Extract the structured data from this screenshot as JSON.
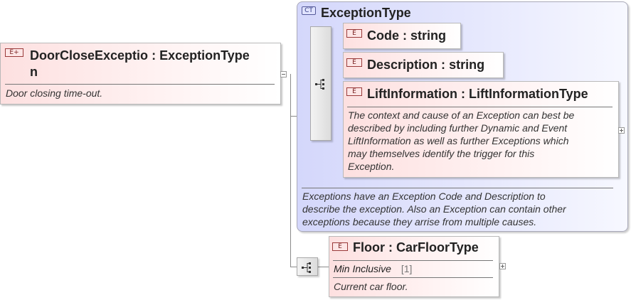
{
  "root_element": {
    "badge": "E",
    "name": "DoorCloseExceptio",
    "name_cont": "n",
    "type": "ExceptionType",
    "doc": "Door closing time-out."
  },
  "complex_type": {
    "badge": "CT",
    "name": "ExceptionType",
    "doc_lines": [
      "Exceptions have an Exception Code and Description to",
      "describe the exception. Also an Exception can contain other",
      "exceptions because they arrise from multiple causes."
    ]
  },
  "children": [
    {
      "badge": "E",
      "name": "Code",
      "type": "string"
    },
    {
      "badge": "E",
      "name": "Description",
      "type": "string"
    },
    {
      "badge": "E",
      "name": "LiftInformation",
      "type": "LiftInformationType",
      "doc_lines": [
        "The context and cause of an Exception can best be",
        "described by including further Dynamic and Event",
        "LiftInformation as well as further Exceptions which",
        "may themselves identify the trigger for this",
        "Exception."
      ]
    }
  ],
  "floor_element": {
    "badge": "E",
    "name": "Floor",
    "type": "CarFloorType",
    "facet_label": "Min Inclusive",
    "facet_value": "[1]",
    "doc": "Current car floor."
  },
  "separator": ":"
}
